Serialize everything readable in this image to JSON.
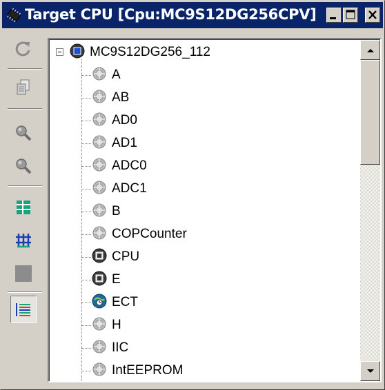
{
  "window": {
    "title": "Target CPU [Cpu:MC9S12DG256CPV]",
    "colors": {
      "titlebar": "#0a246a",
      "face": "#d4d0c8"
    }
  },
  "toolbar": {
    "buttons": [
      {
        "name": "refresh-button",
        "icon": "refresh-icon",
        "pressed": false
      },
      {
        "name": "copy-button",
        "icon": "copy-icon",
        "pressed": false
      },
      {
        "name": "zoom-in-button",
        "icon": "magnifier-icon",
        "pressed": false
      },
      {
        "name": "zoom-out-button",
        "icon": "magnifier-icon",
        "pressed": false
      },
      {
        "name": "grid-view-button",
        "icon": "grid-icon",
        "pressed": false
      },
      {
        "name": "network-view-button",
        "icon": "network-icon",
        "pressed": false
      },
      {
        "name": "block-view-button",
        "icon": "block-icon",
        "pressed": false
      },
      {
        "name": "list-view-button",
        "icon": "list-icon",
        "pressed": true
      }
    ]
  },
  "tree": {
    "root": {
      "label": "MC9S12DG256_112",
      "icon": "cpu-chip-icon",
      "expanded": true
    },
    "items": [
      {
        "label": "A",
        "icon": "component-gear-icon"
      },
      {
        "label": "AB",
        "icon": "component-gear-icon"
      },
      {
        "label": "AD0",
        "icon": "component-gear-icon"
      },
      {
        "label": "AD1",
        "icon": "component-gear-icon"
      },
      {
        "label": "ADC0",
        "icon": "component-gear-icon"
      },
      {
        "label": "ADC1",
        "icon": "component-gear-icon"
      },
      {
        "label": "B",
        "icon": "component-gear-icon"
      },
      {
        "label": "COPCounter",
        "icon": "component-gear-icon"
      },
      {
        "label": "CPU",
        "icon": "cpu-chip-icon"
      },
      {
        "label": "E",
        "icon": "cpu-chip-icon"
      },
      {
        "label": "ECT",
        "icon": "timer-globe-icon"
      },
      {
        "label": "H",
        "icon": "component-gear-icon"
      },
      {
        "label": "IIC",
        "icon": "component-gear-icon"
      },
      {
        "label": "IntEEPROM",
        "icon": "component-gear-icon"
      }
    ]
  },
  "scrollbar": {
    "position": 0.0
  }
}
